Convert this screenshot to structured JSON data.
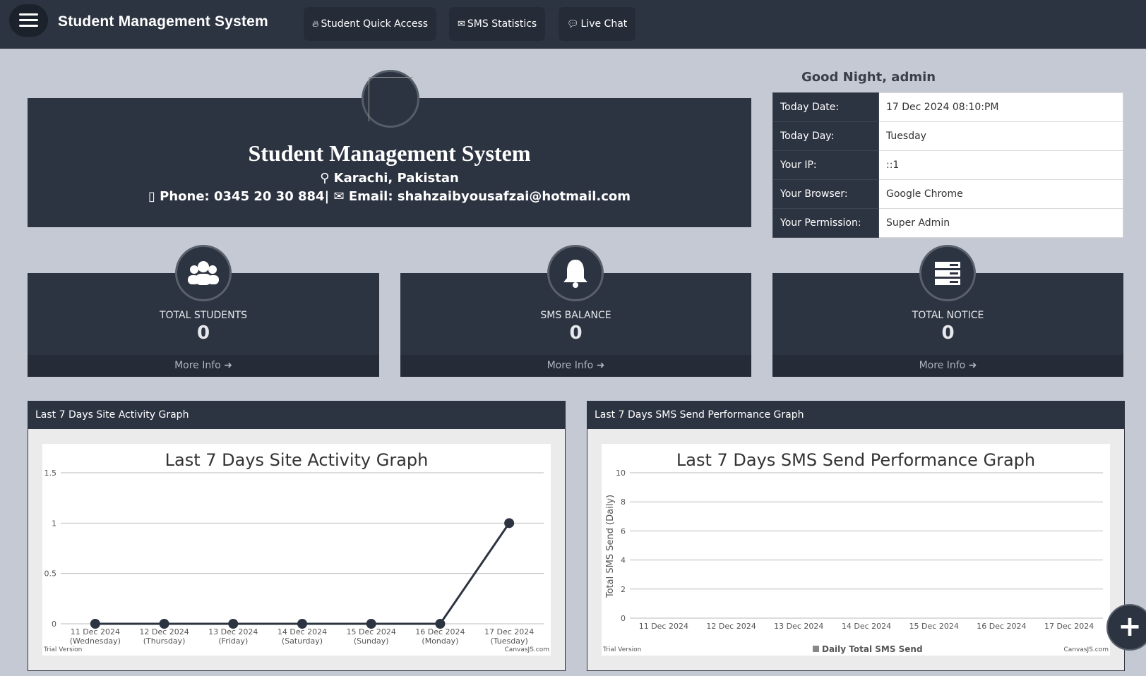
{
  "topbar": {
    "title": "Student Management System",
    "buttons": [
      {
        "label": "Student Quick Access",
        "icon": "fire-icon"
      },
      {
        "label": "SMS Statistics",
        "icon": "envelope-icon"
      },
      {
        "label": "Live Chat",
        "icon": "chat-icon"
      }
    ]
  },
  "banner": {
    "title": "Student Management System",
    "location": "Karachi, Pakistan",
    "phone": "Phone: 0345 20 30 884|",
    "email": "Email: shahzaibyousafzai@hotmail.com"
  },
  "info": {
    "greeting": "Good Night, admin",
    "rows": [
      {
        "label": "Today Date:",
        "value": "17 Dec 2024 08:10:PM"
      },
      {
        "label": "Today Day:",
        "value": "Tuesday"
      },
      {
        "label": "Your IP:",
        "value": "::1"
      },
      {
        "label": "Your Browser:",
        "value": "Google Chrome"
      },
      {
        "label": "Your Permission:",
        "value": "Super Admin"
      }
    ]
  },
  "cards": [
    {
      "label": "TOTAL STUDENTS",
      "count": "0",
      "more": "More Info",
      "icon": "users-icon"
    },
    {
      "label": "SMS BALANCE",
      "count": "0",
      "more": "More Info",
      "icon": "bell-icon"
    },
    {
      "label": "TOTAL NOTICE",
      "count": "0",
      "more": "More Info",
      "icon": "server-icon"
    }
  ],
  "graphs": {
    "activity_header": "Last 7 Days Site Activity Graph",
    "sms_header": "Last 7 Days SMS Send Performance Graph",
    "trial": "Trial Version",
    "credit": "CanvasJS.com"
  },
  "colors": {
    "dark": "#2d3441",
    "page": "#c5c9d3"
  },
  "chart_data": [
    {
      "type": "line",
      "title": "Last 7 Days Site Activity Graph",
      "categories": [
        "11 Dec 2024",
        "12 Dec 2024",
        "13 Dec 2024",
        "14 Dec 2024",
        "15 Dec 2024",
        "16 Dec 2024",
        "17 Dec 2024"
      ],
      "sublabels": [
        "(Wednesday)",
        "(Thursday)",
        "(Friday)",
        "(Saturday)",
        "(Sunday)",
        "(Monday)",
        "(Tuesday)"
      ],
      "values": [
        0,
        0,
        0,
        0,
        0,
        0,
        1
      ],
      "yticks": [
        "0",
        "0.5",
        "1",
        "1.5"
      ],
      "ylim": [
        0,
        1.5
      ],
      "xlabel": "",
      "ylabel": "",
      "grid": true
    },
    {
      "type": "bar",
      "title": "Last 7 Days SMS Send Performance Graph",
      "categories": [
        "11 Dec 2024",
        "12 Dec 2024",
        "13 Dec 2024",
        "14 Dec 2024",
        "15 Dec 2024",
        "16 Dec 2024",
        "17 Dec 2024"
      ],
      "series": [
        {
          "name": "Daily Total SMS Send",
          "values": [
            0,
            0,
            0,
            0,
            0,
            0,
            0
          ]
        }
      ],
      "yticks": [
        "0",
        "2",
        "4",
        "6",
        "8",
        "10"
      ],
      "ylim": [
        0,
        10
      ],
      "xlabel": "",
      "ylabel": "Total SMS Send (Daily)",
      "legend": "bottom",
      "grid": true
    }
  ]
}
